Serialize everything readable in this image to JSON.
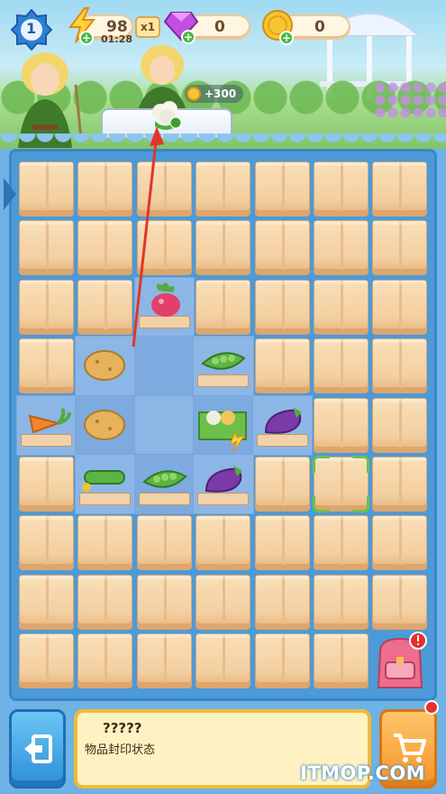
{
  "hud": {
    "level": "1",
    "energy": "98",
    "energy_timer": "01:28",
    "multiplier": "x1",
    "gems": "0",
    "coins": "0"
  },
  "order": {
    "reward": "+300",
    "item_icon": "cauliflower-icon"
  },
  "board": {
    "columns": 7,
    "rows": 9,
    "cells": [
      [
        "box",
        "box",
        "box",
        "box",
        "box",
        "box",
        "box"
      ],
      [
        "box",
        "box",
        "box",
        "box",
        "box",
        "box",
        "box"
      ],
      [
        "box",
        "box",
        "radish",
        "box",
        "box",
        "box",
        "box"
      ],
      [
        "box",
        "potato",
        "empty",
        "peas",
        "box",
        "box",
        "box"
      ],
      [
        "carrot",
        "potato",
        "empty",
        "veg-crate",
        "eggplant",
        "box",
        "box"
      ],
      [
        "box",
        "cucumber",
        "peas",
        "eggplant",
        "box",
        "selected-box",
        "box"
      ],
      [
        "box",
        "box",
        "box",
        "box",
        "box",
        "box",
        "box"
      ],
      [
        "box",
        "box",
        "box",
        "box",
        "box",
        "box",
        "box"
      ],
      [
        "box",
        "box",
        "box",
        "box",
        "box",
        "box",
        "backpack"
      ]
    ]
  },
  "info_panel": {
    "title": "?????",
    "description": "物品封印状态"
  },
  "colors": {
    "board_bg": "#4c9ad8",
    "box": "#f3cfa0",
    "accent_orange": "#f59427",
    "exit_blue": "#2e8fd8"
  },
  "watermark": "ITMOP.COM"
}
